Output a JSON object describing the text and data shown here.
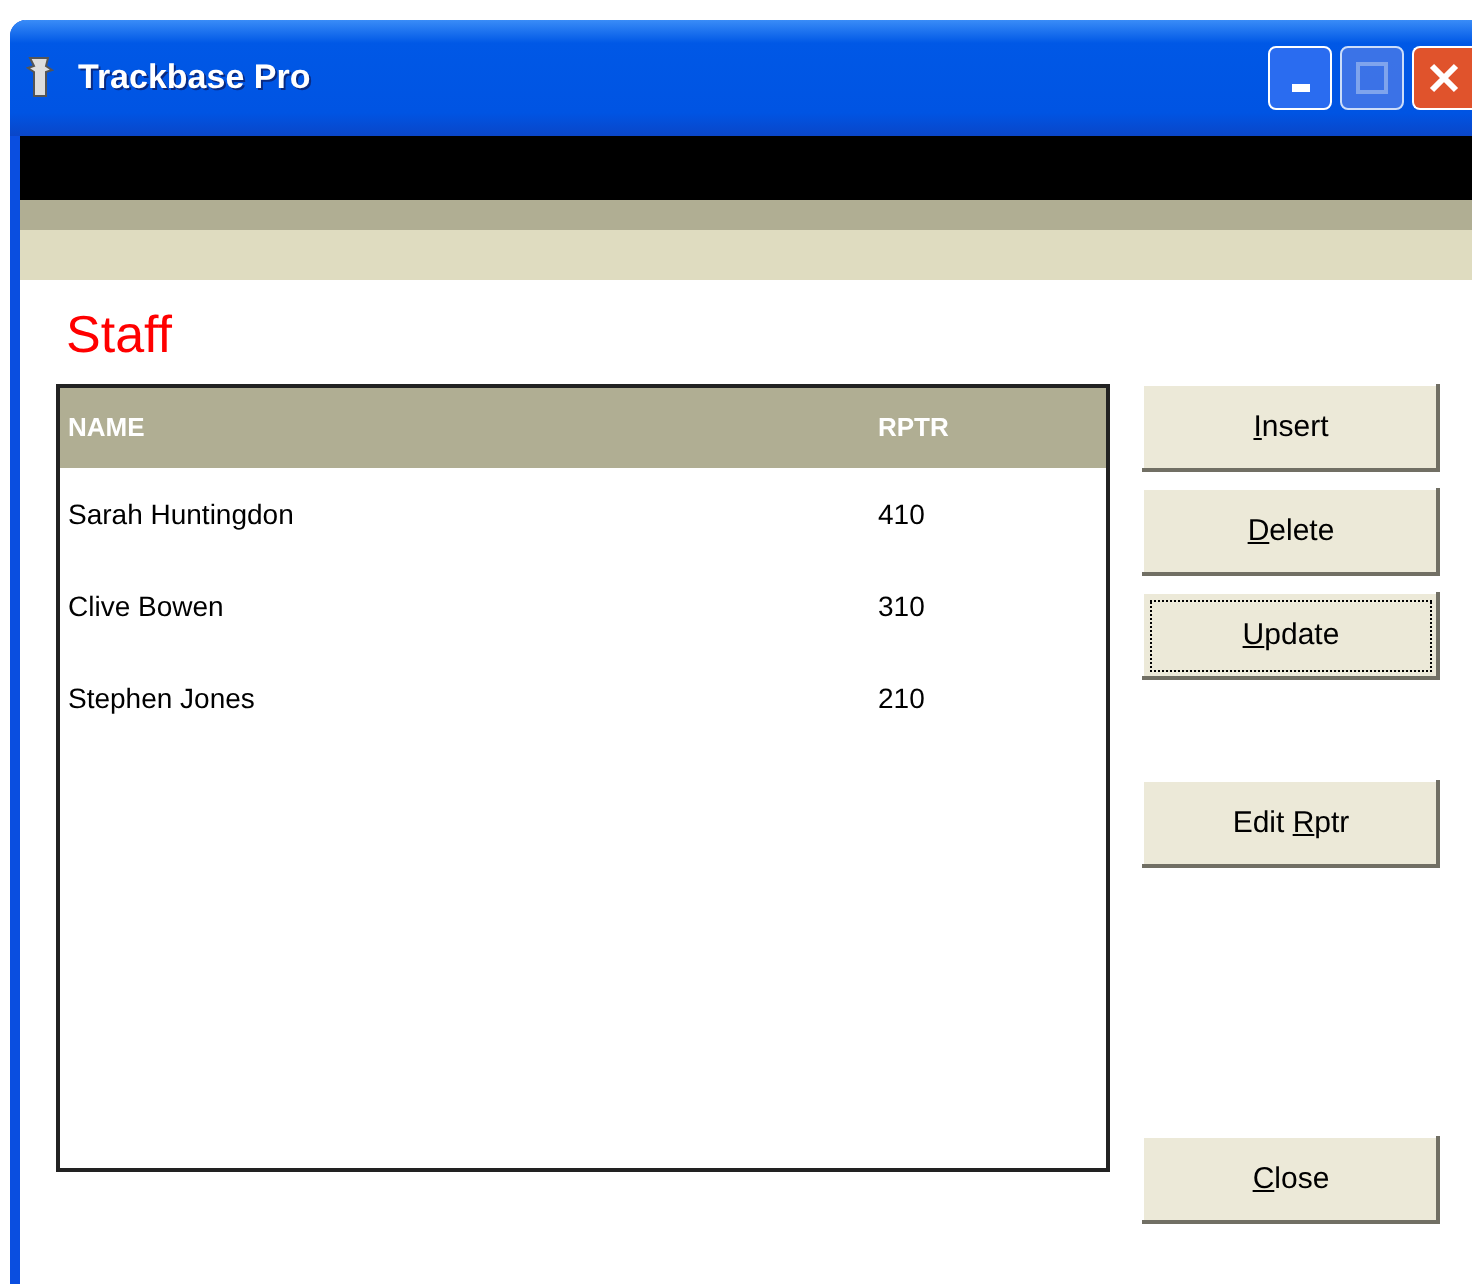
{
  "window": {
    "title": "Trackbase Pro"
  },
  "heading": "Staff",
  "table": {
    "columns": [
      "NAME",
      "RPTR"
    ],
    "rows": [
      [
        "Sarah Huntingdon",
        "410"
      ],
      [
        "Clive Bowen",
        "310"
      ],
      [
        "Stephen Jones",
        "210"
      ]
    ]
  },
  "buttons": [
    {
      "key": "I",
      "after": "nsert",
      "focused": false
    },
    {
      "key": "D",
      "after": "elete",
      "focused": false
    },
    {
      "key": "U",
      "after": "pdate",
      "focused": true
    },
    {
      "before": "Edit ",
      "key": "R",
      "after": "ptr",
      "focused": false
    },
    {
      "key": "C",
      "after": "lose",
      "focused": false
    }
  ]
}
